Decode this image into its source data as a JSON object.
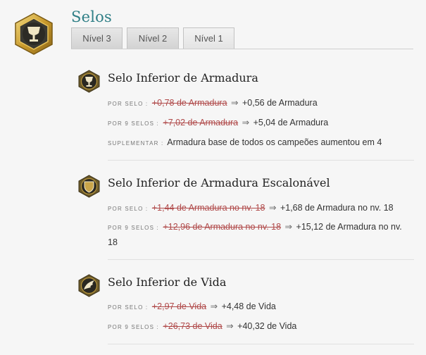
{
  "page": {
    "title": "Selos"
  },
  "tabs": [
    {
      "label": "Nível 3"
    },
    {
      "label": "Nível 2"
    },
    {
      "label": "Nível 1"
    }
  ],
  "items": [
    {
      "title": "Selo Inferior de Armadura",
      "icon": "goblet-rune-icon",
      "rows": [
        {
          "label": "POR SELO :",
          "old": "+0,78 de Armadura",
          "new": "+0,56 de Armadura"
        },
        {
          "label": "POR 9 SELOS :",
          "old": "+7,02 de Armadura",
          "new": "+5,04 de Armadura"
        },
        {
          "label": "SUPLEMENTAR :",
          "text": "Armadura base de todos os campeões aumentou em 4"
        }
      ]
    },
    {
      "title": "Selo Inferior de Armadura Escalonável",
      "icon": "shield-rune-icon",
      "rows": [
        {
          "label": "POR SELO :",
          "old": "+1,44 de Armadura no nv. 18",
          "new": "+1,68 de Armadura no nv. 18"
        },
        {
          "label": "POR 9 SELOS :",
          "old": "+12,96 de Armadura no nv. 18",
          "new": "+15,12 de Armadura no nv. 18"
        }
      ]
    },
    {
      "title": "Selo Inferior de Vida",
      "icon": "wing-rune-icon",
      "rows": [
        {
          "label": "POR SELO :",
          "old": "+2,97 de Vida",
          "new": "+4,48 de Vida"
        },
        {
          "label": "POR 9 SELOS :",
          "old": "+26,73 de Vida",
          "new": "+40,32 de Vida"
        }
      ]
    }
  ],
  "colors": {
    "title": "#2f7f86",
    "old_value": "#b04a4a",
    "gold": "#c8a232"
  },
  "arrow_glyph": "⇒"
}
